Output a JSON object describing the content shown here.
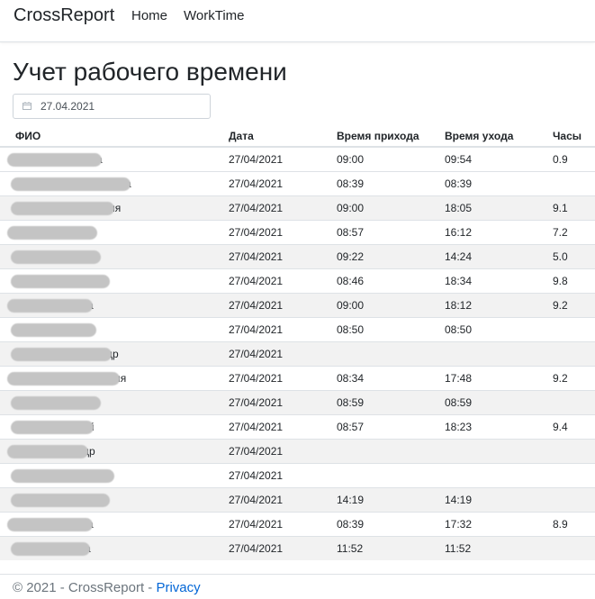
{
  "navbar": {
    "brand": "CrossReport",
    "links": [
      "Home",
      "WorkTime"
    ]
  },
  "page": {
    "title": "Учет рабочего времени",
    "date_value": "27.04.2021"
  },
  "table": {
    "headers": [
      "ФИО",
      "Дата",
      "Время прихода",
      "Время ухода",
      "Часы"
    ],
    "rows": [
      {
        "fio_tail": "а",
        "date": "27/04/2021",
        "in": "09:00",
        "out": "09:54",
        "hours": "0.9"
      },
      {
        "fio_tail": "а",
        "date": "27/04/2021",
        "in": "08:39",
        "out": "08:39",
        "hours": ""
      },
      {
        "fio_tail": "ия",
        "date": "27/04/2021",
        "in": "09:00",
        "out": "18:05",
        "hours": "9.1"
      },
      {
        "fio_tail": "",
        "date": "27/04/2021",
        "in": "08:57",
        "out": "16:12",
        "hours": "7.2"
      },
      {
        "fio_tail": "",
        "date": "27/04/2021",
        "in": "09:22",
        "out": "14:24",
        "hours": "5.0"
      },
      {
        "fio_tail": "",
        "date": "27/04/2021",
        "in": "08:46",
        "out": "18:34",
        "hours": "9.8"
      },
      {
        "fio_tail": "а",
        "date": "27/04/2021",
        "in": "09:00",
        "out": "18:12",
        "hours": "9.2"
      },
      {
        "fio_tail": "",
        "date": "27/04/2021",
        "in": "08:50",
        "out": "08:50",
        "hours": ""
      },
      {
        "fio_tail": "др",
        "date": "27/04/2021",
        "in": "",
        "out": "",
        "hours": ""
      },
      {
        "fio_tail": "ия",
        "date": "27/04/2021",
        "in": "08:34",
        "out": "17:48",
        "hours": "9.2"
      },
      {
        "fio_tail": "",
        "date": "27/04/2021",
        "in": "08:59",
        "out": "08:59",
        "hours": ""
      },
      {
        "fio_tail": "й",
        "date": "27/04/2021",
        "in": "08:57",
        "out": "18:23",
        "hours": "9.4"
      },
      {
        "fio_tail": "др",
        "date": "27/04/2021",
        "in": "",
        "out": "",
        "hours": ""
      },
      {
        "fio_tail": "",
        "date": "27/04/2021",
        "in": "",
        "out": "",
        "hours": ""
      },
      {
        "fio_tail": "",
        "date": "27/04/2021",
        "in": "14:19",
        "out": "14:19",
        "hours": ""
      },
      {
        "fio_tail": "а",
        "date": "27/04/2021",
        "in": "08:39",
        "out": "17:32",
        "hours": "8.9"
      },
      {
        "fio_tail": "а",
        "date": "27/04/2021",
        "in": "11:52",
        "out": "11:52",
        "hours": ""
      }
    ]
  },
  "footer": {
    "text": "© 2021 - CrossReport - ",
    "privacy": "Privacy"
  }
}
